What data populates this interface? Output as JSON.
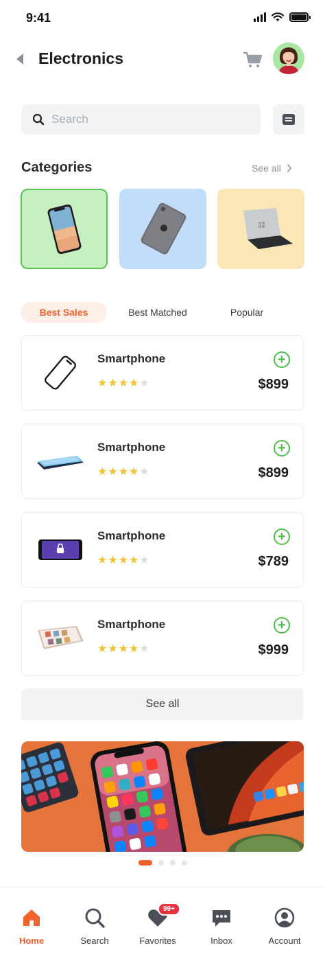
{
  "status_bar": {
    "time": "9:41"
  },
  "header": {
    "title": "Electronics"
  },
  "search": {
    "placeholder": "Search"
  },
  "categories": {
    "title": "Categories",
    "see_all": "See all"
  },
  "tabs": [
    {
      "label": "Best Sales",
      "active": true
    },
    {
      "label": "Best Matched",
      "active": false
    },
    {
      "label": "Popular",
      "active": false
    }
  ],
  "products": [
    {
      "name": "Smartphone",
      "rating": 4,
      "max_rating": 5,
      "price": "$899"
    },
    {
      "name": "Smartphone",
      "rating": 4,
      "max_rating": 5,
      "price": "$899"
    },
    {
      "name": "Smartphone",
      "rating": 4,
      "max_rating": 5,
      "price": "$789"
    },
    {
      "name": "Smartphone",
      "rating": 4,
      "max_rating": 5,
      "price": "$999"
    }
  ],
  "see_all_button": "See all",
  "carousel": {
    "slides": 4,
    "active_index": 0
  },
  "bottom_nav": [
    {
      "label": "Home",
      "icon": "home-icon",
      "active": true
    },
    {
      "label": "Search",
      "icon": "search-icon",
      "active": false
    },
    {
      "label": "Favorites",
      "icon": "heart-icon",
      "active": false,
      "badge": "99+"
    },
    {
      "label": "Inbox",
      "icon": "chat-icon",
      "active": false
    },
    {
      "label": "Account",
      "icon": "user-icon",
      "active": false
    }
  ],
  "colors": {
    "accent": "#f0642b",
    "add_green": "#4fbe4a",
    "star": "#f2c230",
    "category_green": "#c6efc2",
    "category_blue": "#c2ddfa",
    "category_yellow": "#fbe7b5"
  }
}
